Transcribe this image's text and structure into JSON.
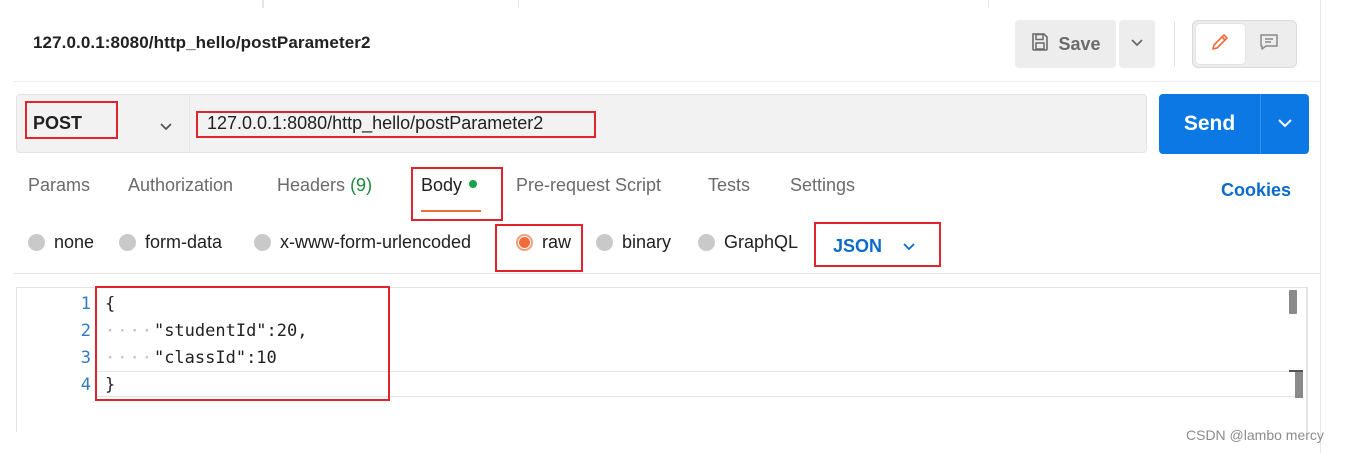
{
  "request": {
    "title": "127.0.0.1:8080/http_hello/postParameter2",
    "method": "POST",
    "url": "127.0.0.1:8080/http_hello/postParameter2"
  },
  "toolbar": {
    "save_label": "Save",
    "send_label": "Send"
  },
  "tabs": [
    {
      "label": "Params"
    },
    {
      "label": "Authorization"
    },
    {
      "label": "Headers",
      "count": "(9)"
    },
    {
      "label": "Body"
    },
    {
      "label": "Pre-request Script"
    },
    {
      "label": "Tests"
    },
    {
      "label": "Settings"
    }
  ],
  "cookies_label": "Cookies",
  "body_types": [
    {
      "label": "none"
    },
    {
      "label": "form-data"
    },
    {
      "label": "x-www-form-urlencoded"
    },
    {
      "label": "raw",
      "selected": true
    },
    {
      "label": "binary"
    },
    {
      "label": "GraphQL"
    }
  ],
  "language": "JSON",
  "editor": {
    "line_numbers": [
      "1",
      "2",
      "3",
      "4"
    ],
    "lines": [
      "{",
      "\"studentId\":20,",
      "\"classId\":10",
      "}"
    ]
  },
  "colors": {
    "accent_orange": "#f26b3a",
    "send_blue": "#0b78e3",
    "link_blue": "#0b6bcb",
    "highlight_red": "#e0232c"
  },
  "watermark": "CSDN @lambo mercy"
}
